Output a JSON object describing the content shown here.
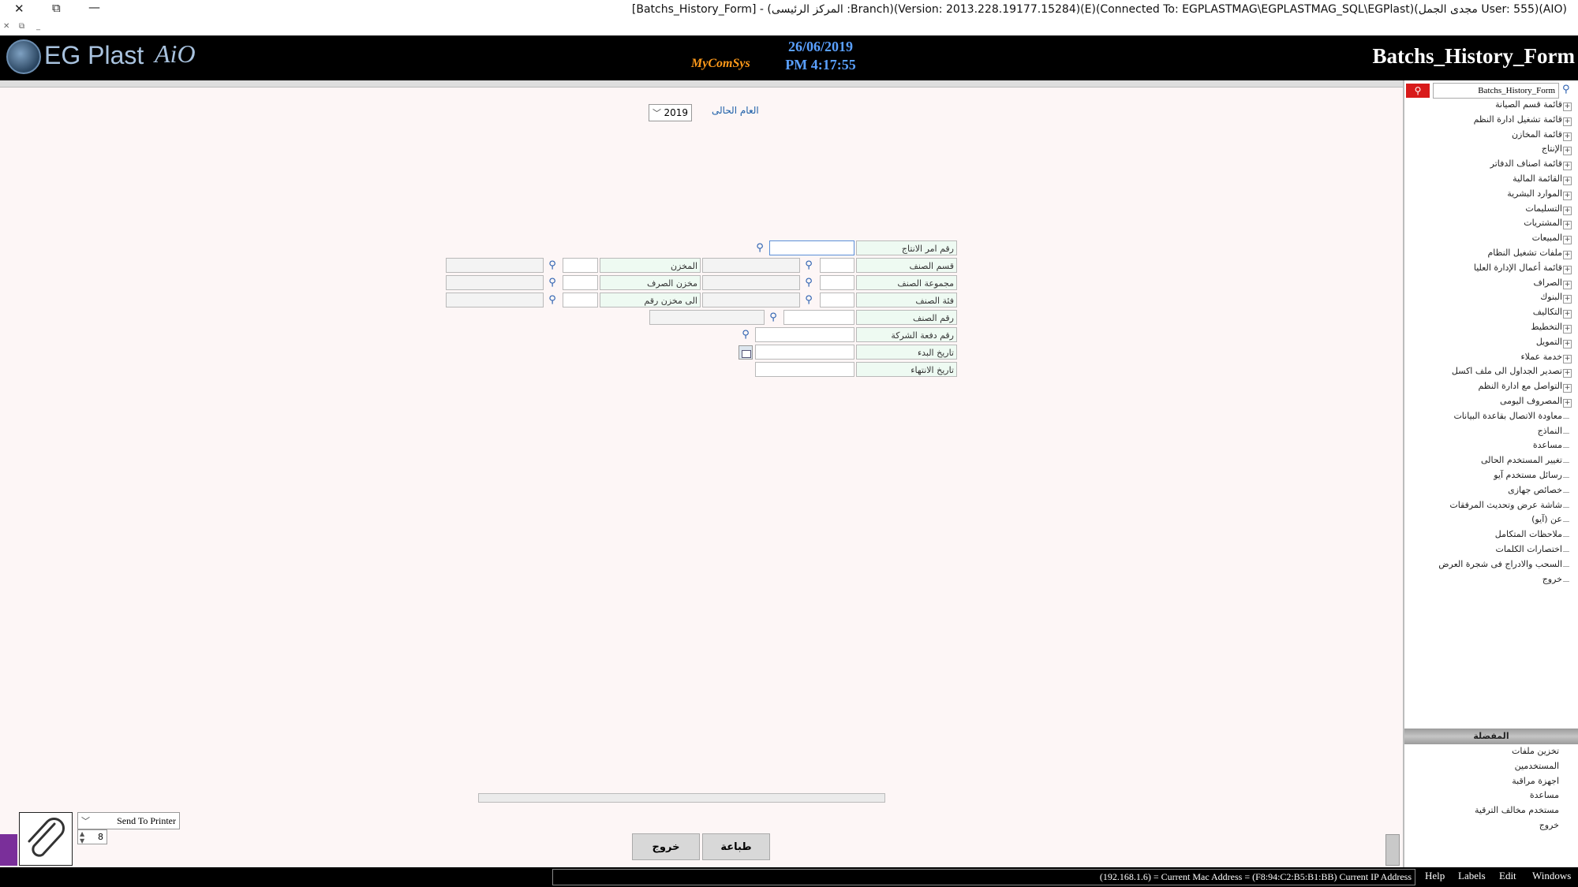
{
  "window": {
    "title": "[Batchs_History_Form] - (المركز الرئيسى :Branch)(Version: 2013.228.19177.15284)(E)(Connected To: EGPLASTMAG\\EGPLASTMAG_SQL\\EGPlast)(مجدى الجمل User: 555)(AIO)",
    "close": "✕",
    "restore": "⧉",
    "minimize": "—"
  },
  "header": {
    "logo_text": "EG Plast",
    "logo_suffix": "AiO",
    "mcs_logo": "MyComSys",
    "date": "26/06/2019",
    "time": "PM 4:17:55",
    "form_title": "Batchs_History_Form"
  },
  "year": {
    "label": "العام الحالى",
    "value": "2019"
  },
  "form": {
    "production_order_label": "رقم امر الانتاج",
    "item_section_label": "قسم الصنف",
    "item_group_label": "مجموعة الصنف",
    "item_class_label": "فئة الصنف",
    "item_number_label": "رقم الصنف",
    "company_batch_label": "رقم دفعة الشركة",
    "start_date_label": "تاريخ البدء",
    "end_date_label": "تاريخ الانتهاء",
    "store_label": "المخزن",
    "issue_store_label": "مخزن الصرف",
    "to_store_label": "الى مخزن رقم"
  },
  "buttons": {
    "print": "طباعة",
    "exit": "خروج"
  },
  "printer": {
    "target": "Send To Printer",
    "copies": "8"
  },
  "side": {
    "search_value": "Batchs_History_Form",
    "tree": [
      {
        "label": "قائمة قسم الصيانة",
        "expandable": true
      },
      {
        "label": "قائمة تشغيل ادارة النظم",
        "expandable": true
      },
      {
        "label": "قائمة المخازن",
        "expandable": true
      },
      {
        "label": "الإنتاج",
        "expandable": true
      },
      {
        "label": "قائمة اصناف الدفاتر",
        "expandable": true
      },
      {
        "label": "القائمة المالية",
        "expandable": true
      },
      {
        "label": "الموارد البشرية",
        "expandable": true
      },
      {
        "label": "التسليمات",
        "expandable": true
      },
      {
        "label": "المشتريات",
        "expandable": true
      },
      {
        "label": "المبيعات",
        "expandable": true
      },
      {
        "label": "ملفات تشغيل النظام",
        "expandable": true
      },
      {
        "label": "قائمة أعمال الإدارة العليا",
        "expandable": true
      },
      {
        "label": "الصراف",
        "expandable": true
      },
      {
        "label": "البنوك",
        "expandable": true
      },
      {
        "label": "التكاليف",
        "expandable": true
      },
      {
        "label": "التخطيط",
        "expandable": true
      },
      {
        "label": "التمويل",
        "expandable": true
      },
      {
        "label": "خدمة عملاء",
        "expandable": true
      },
      {
        "label": "تصدير الجداول الى ملف اكسل",
        "expandable": true
      },
      {
        "label": "التواصل مع ادارة النظم",
        "expandable": true
      },
      {
        "label": "المصروف اليومى",
        "expandable": true
      },
      {
        "label": "معاودة الاتصال بقاعدة البيانات",
        "expandable": false
      },
      {
        "label": "النماذج",
        "expandable": false
      },
      {
        "label": "مساعدة",
        "expandable": false
      },
      {
        "label": "تغيير المستخدم الحالى",
        "expandable": false
      },
      {
        "label": "رسائل مستخدم آيو",
        "expandable": false
      },
      {
        "label": "خصائص جهازى",
        "expandable": false
      },
      {
        "label": "شاشة عرض وتحديث المرفقات",
        "expandable": false
      },
      {
        "label": "عن (آيو)",
        "expandable": false
      },
      {
        "label": "ملاحظات المتكامل",
        "expandable": false
      },
      {
        "label": "اختصارات الكلمات",
        "expandable": false
      },
      {
        "label": "السحب والادراج فى شجرة العرض",
        "expandable": false
      },
      {
        "label": "خروج",
        "expandable": false
      }
    ],
    "shortcuts_title": "المفضلة",
    "shortcuts": [
      "تخزين ملفات",
      "المستخدمين",
      "اجهزة مراقبة",
      "مساعدة",
      "مستخدم مخالف الترقية",
      "خروج"
    ]
  },
  "status": {
    "info": "(192.168.1.6) = Current Mac Address = (F8:94:C2:B5:B1:BB) Current IP Address",
    "menu": [
      "Help",
      "Labels",
      "Edit",
      "Windows"
    ]
  }
}
